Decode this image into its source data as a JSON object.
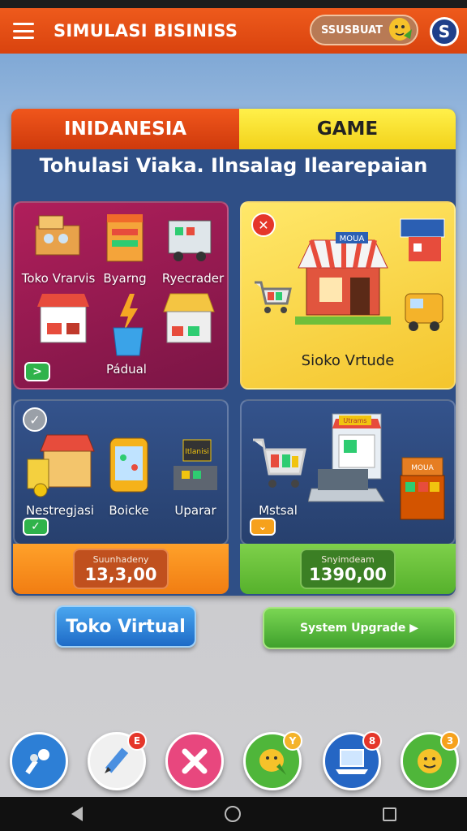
{
  "app": {
    "title": "SIMULASI BISINISS",
    "user_pill": "SSUSBUAT",
    "avatar_letter": "S"
  },
  "tabs": [
    {
      "label": "INIDANESIA"
    },
    {
      "label": "GAME"
    }
  ],
  "subtitle": "Tohulasi Viaka. Ilnsalag Ilearepaian",
  "cards": {
    "top_left": {
      "items": [
        "Toko Vrarvis",
        "Byarng",
        "Ryecrader",
        "Pádual"
      ],
      "badge": ">"
    },
    "top_right": {
      "label": "Sioko Vrtude",
      "shop_sign": "MOUA"
    },
    "bottom_left": {
      "items": [
        "Nestregjasi",
        "Boicke",
        "Uparar"
      ],
      "sign": "Itlanisi"
    },
    "bottom_right": {
      "items": [
        "Mstsal"
      ],
      "signs": [
        "Utrams",
        "MOUA"
      ]
    }
  },
  "values": [
    {
      "label": "Suunhadeny",
      "value": "13,3,00"
    },
    {
      "label": "Snyimdeam",
      "value": "1390,00"
    }
  ],
  "buttons": {
    "toko_virtual": "Toko Virtual",
    "system_upgrade": "System Upgrade ▶"
  },
  "dock": [
    {
      "icon": "keys-icon",
      "color": "#2d7fd6",
      "badge": ""
    },
    {
      "icon": "pen-icon",
      "color": "#f0f0f0",
      "badge": "E"
    },
    {
      "icon": "close-icon",
      "color": "#e8477e",
      "badge": ""
    },
    {
      "icon": "chat-mascot-icon",
      "color": "#4fb63a",
      "badge": "Y"
    },
    {
      "icon": "laptop-icon",
      "color": "#2566c4",
      "badge": "8"
    },
    {
      "icon": "smiley-icon",
      "color": "#4fb63a",
      "badge": "3"
    }
  ],
  "colors": {
    "appbar": "#e04a12",
    "panel": "#2f4f86",
    "accent_orange": "#f17d12",
    "accent_green": "#56b12c",
    "accent_yellow": "#f2d21a"
  }
}
